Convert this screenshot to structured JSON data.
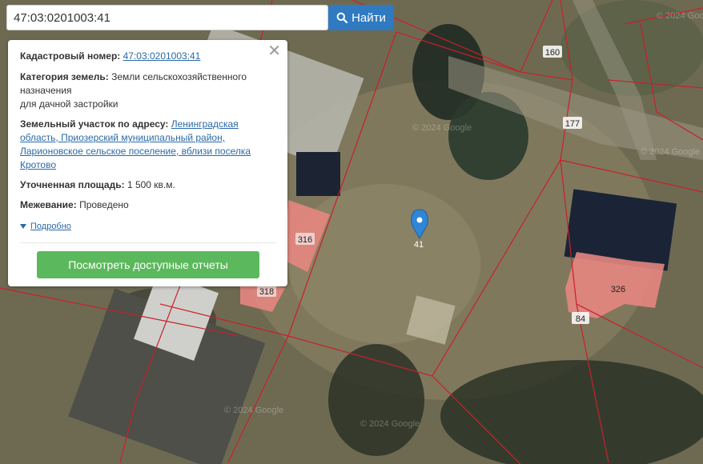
{
  "search": {
    "value": "47:03:0201003:41",
    "button_label": "Найти",
    "button_icon": "search-icon"
  },
  "info_card": {
    "cadastral_label": "Кадастровый номер:",
    "cadastral_value": "47:03:0201003:41",
    "category_label": "Категория земель:",
    "category_value_line1": "Земли сельскохозяйственного",
    "category_value_line2": "назначения",
    "category_value_line3": "для дачной застройки",
    "address_label": "Земельный участок по адресу:",
    "address_value_line1": "Ленинградская",
    "address_value_line2": "область, Приозерский муниципальный район,",
    "address_value_line3": "Ларионовское сельское поселение, вблизи поселка",
    "address_value_line4": "Кротово",
    "area_label": "Уточненная площадь:",
    "area_value": "1 500 кв.м.",
    "survey_label": "Межевание:",
    "survey_value": "Проведено",
    "more_label": "Подробно",
    "reports_button": "Посмотреть доступные отчеты",
    "close_icon": "close-icon"
  },
  "map": {
    "marker_label": "41",
    "marker_color": "#2f86d6",
    "boundary_color": "#c8202a",
    "building_color": "#e58680",
    "plot_labels": [
      "160",
      "177",
      "316",
      "318",
      "326",
      "84"
    ],
    "watermarks": [
      "© 2024 Google",
      "© 2024 Google",
      "© 2024 Google",
      "© 2024 Google",
      "© 2024 Google"
    ]
  }
}
